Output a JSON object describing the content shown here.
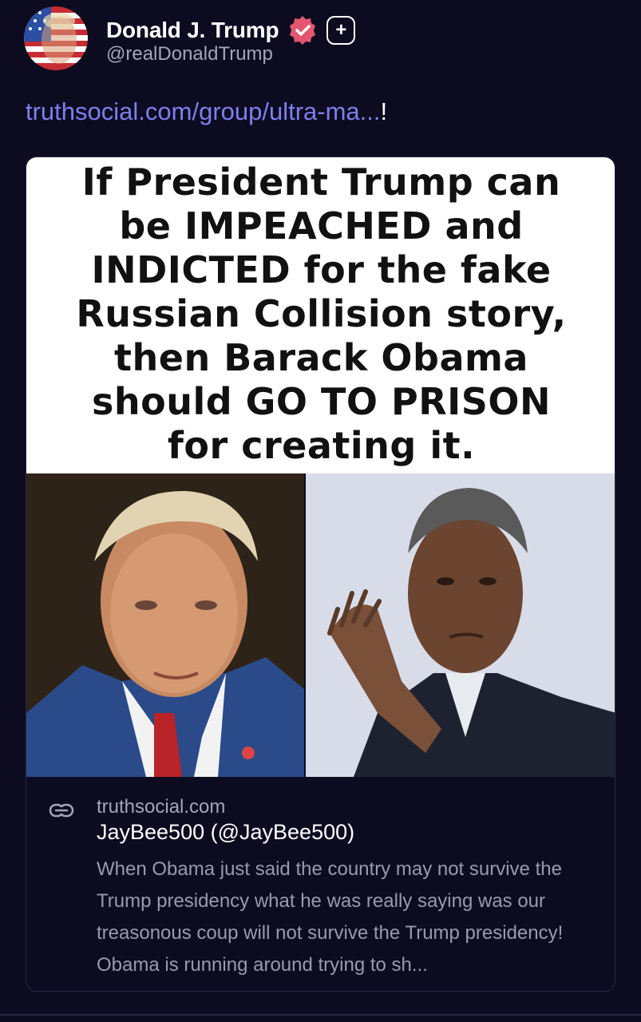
{
  "post": {
    "author_name": "Donald J. Trump",
    "author_handle": "@realDonaldTrump",
    "link_text": "truthsocial.com/group/ultra-ma...",
    "link_suffix": "!"
  },
  "meme": {
    "lines": [
      "If President Trump can",
      "be IMPEACHED and",
      "INDICTED for the fake",
      "Russian Collision story,",
      "then Barack Obama",
      "should GO TO PRISON",
      "for creating it."
    ]
  },
  "preview": {
    "domain": "truthsocial.com",
    "title": "JayBee500 (@JayBee500)",
    "description": "When Obama just said the country may not survive the Trump presidency what he was really saying was our treasonous coup will not survive the Trump presidency! Obama is running around trying to sh..."
  },
  "icons": {
    "verified": "verified-badge-icon",
    "plus": "plus-icon",
    "link": "link-icon"
  },
  "colors": {
    "background": "#0d0b1f",
    "link": "#7d80ef",
    "verified": "#e2566f",
    "muted": "#a7a4b8"
  }
}
